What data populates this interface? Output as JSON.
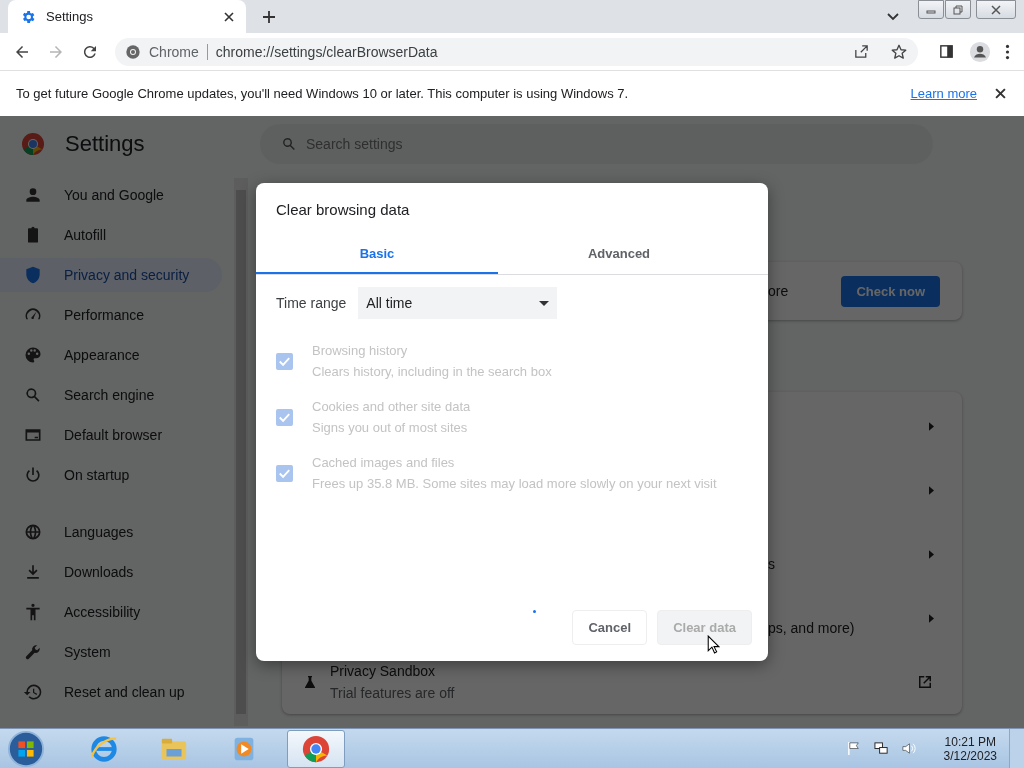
{
  "browser": {
    "tab": {
      "title": "Settings",
      "selected": true
    },
    "nav": [
      {
        "kind": "back",
        "disabled": false
      },
      {
        "kind": "forward",
        "disabled": true
      },
      {
        "kind": "reload",
        "disabled": false
      }
    ],
    "omnibox": {
      "chip": "Chrome",
      "url": "chrome://settings/clearBrowserData"
    }
  },
  "infobar": {
    "message": "To get future Google Chrome updates, you'll need Windows 10 or later. This computer is using Windows 7.",
    "link": "Learn more"
  },
  "settings": {
    "title": "Settings",
    "search": {
      "placeholder": "Search settings"
    },
    "sidebar": {
      "sections": [
        {
          "items": [
            {
              "label": "You and Google",
              "selected": false
            },
            {
              "label": "Autofill",
              "selected": false
            },
            {
              "label": "Privacy and security",
              "selected": true
            },
            {
              "label": "Performance",
              "selected": false
            },
            {
              "label": "Appearance",
              "selected": false
            },
            {
              "label": "Search engine",
              "selected": false
            },
            {
              "label": "Default browser",
              "selected": false
            },
            {
              "label": "On startup",
              "selected": false
            }
          ]
        },
        {
          "items": [
            {
              "label": "Languages",
              "selected": false
            },
            {
              "label": "Downloads",
              "selected": false
            },
            {
              "label": "Accessibility",
              "selected": false
            },
            {
              "label": "System",
              "selected": false
            },
            {
              "label": "Reset and clean up",
              "selected": false
            }
          ]
        }
      ]
    },
    "safety_card": {
      "text": "ore",
      "button": "Check now"
    },
    "privacy_card": {
      "rows": [
        {
          "kind": "arrow"
        },
        {
          "kind": "arrow"
        },
        {
          "kind": "arrow",
          "text": "s"
        },
        {
          "kind": "arrow",
          "text": "ps, and more)"
        },
        {
          "kind": "external",
          "title": "Privacy Sandbox",
          "subtitle": "Trial features are off"
        }
      ]
    }
  },
  "dialog": {
    "title": "Clear browsing data",
    "tabs": [
      {
        "label": "Basic",
        "selected": true
      },
      {
        "label": "Advanced",
        "selected": false
      }
    ],
    "time_range": {
      "label": "Time range",
      "value": "All time"
    },
    "options": [
      {
        "title": "Browsing history",
        "description": "Clears history, including in the search box",
        "checked": true,
        "disabled": true
      },
      {
        "title": "Cookies and other site data",
        "description": "Signs you out of most sites",
        "checked": true,
        "disabled": true
      },
      {
        "title": "Cached images and files",
        "description": "Frees up 35.8 MB. Some sites may load more slowly on your next visit",
        "checked": true,
        "disabled": true
      }
    ],
    "busy": true,
    "buttons": [
      {
        "label": "Cancel",
        "kind": "cancel",
        "disabled": false
      },
      {
        "label": "Clear data",
        "kind": "primary",
        "disabled": true
      }
    ]
  },
  "taskbar": {
    "apps": [
      {
        "selected": false
      },
      {
        "selected": false
      },
      {
        "selected": false
      },
      {
        "selected": true
      }
    ],
    "clock": {
      "time": "10:21 PM",
      "date": "3/12/2023"
    }
  }
}
